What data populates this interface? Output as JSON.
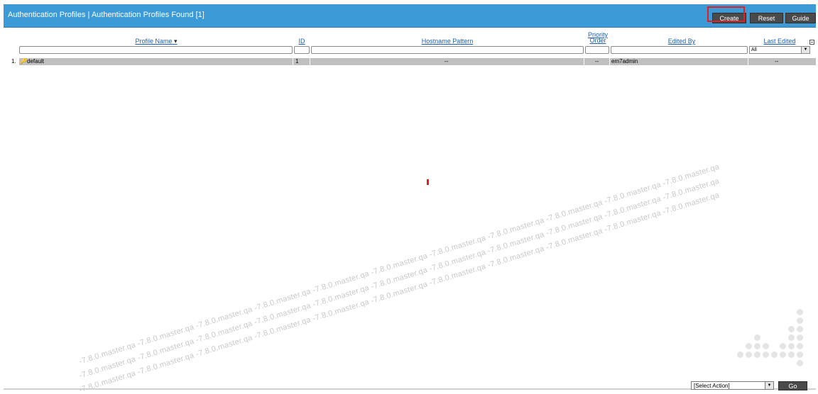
{
  "header": {
    "title": "Authentication Profiles | Authentication Profiles Found [1]",
    "buttons": {
      "create": "Create",
      "reset": "Reset",
      "guide": "Guide"
    }
  },
  "columns": {
    "profile_name": "Profile Name",
    "sort_indicator": "▾",
    "id": "ID",
    "hostname_pattern": "Hostname Pattern",
    "priority_line1": "Priority",
    "priority_line2": "Order",
    "edited_by": "Edited By",
    "last_edited": "Last Edited"
  },
  "filters": {
    "last_edited_select": "All"
  },
  "rows": [
    {
      "num": "1.",
      "profile_name": "default",
      "id": "1",
      "hostname_pattern": "--",
      "priority_order": "--",
      "edited_by": "em7admin",
      "last_edited": "--"
    }
  ],
  "watermark": {
    "text": "-7.8.0.master.qa  -7.8.0.master.qa  -7.8.0.master.qa  -7.8.0.master.qa  -7.8.0.master.qa  -7.8.0.master.qa  -7.8.0.master.qa  -7.8.0.master.qa  -7.8.0.master.qa  -7.8.0.master.qa  -7.8.0.master.qa"
  },
  "footer": {
    "action_select": "[Select Action]",
    "go_label": "Go"
  },
  "colors": {
    "titlebar": "#3c9ad6",
    "button_bg": "#4a4a4a",
    "row_bg": "#c0c0c0",
    "link": "#1a5fb4",
    "highlight": "#e02020"
  },
  "icons": {
    "profile": "key-icon",
    "select_arrow": "chevron-down-icon",
    "column_toggle": "column-toggle-icon",
    "loading": "loading-indicator"
  }
}
